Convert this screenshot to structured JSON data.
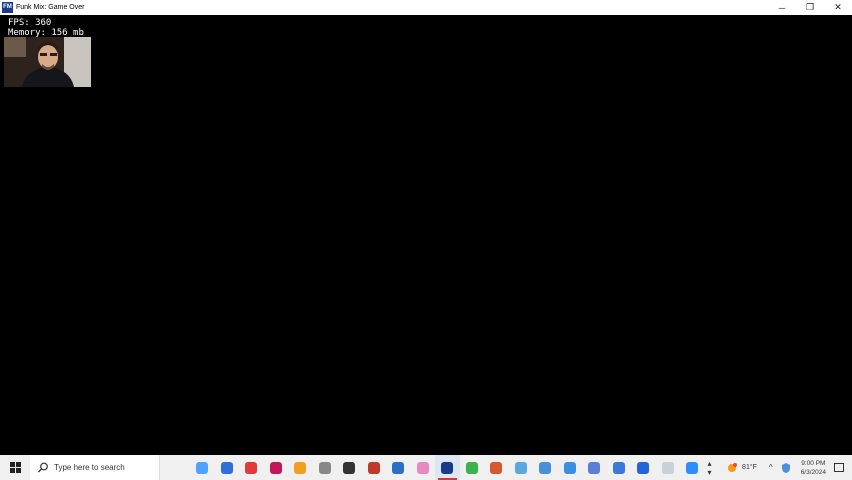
{
  "window": {
    "title": "Funk Mix: Game Over",
    "icon": "app-logo-icon",
    "icon_text": "FM",
    "controls": {
      "minimize": "─",
      "restore": "❐",
      "close": "✕"
    }
  },
  "overlay": {
    "fps_text": "FPS: 360",
    "memory_text": "Memory: 156 mb"
  },
  "webcam": {
    "label": "webcam feed"
  },
  "taskbar": {
    "search_placeholder": "Type here to search",
    "apps": [
      {
        "name": "app-1",
        "color": "#4da3ff"
      },
      {
        "name": "app-2",
        "color": "#2f6fd8"
      },
      {
        "name": "app-3",
        "color": "#e03a3a"
      },
      {
        "name": "app-4",
        "color": "#c2185b"
      },
      {
        "name": "app-5",
        "color": "#f0a020"
      },
      {
        "name": "app-6",
        "color": "#888888"
      },
      {
        "name": "app-7",
        "color": "#333333"
      },
      {
        "name": "app-8",
        "color": "#c0392b"
      },
      {
        "name": "app-9",
        "color": "#2b6fc9"
      },
      {
        "name": "app-10",
        "color": "#e88ac0"
      },
      {
        "name": "app-11",
        "color": "#1b3a8a",
        "active": true
      },
      {
        "name": "app-12",
        "color": "#3bb34a"
      },
      {
        "name": "app-13",
        "color": "#d9572e"
      },
      {
        "name": "app-14",
        "color": "#5aa8e0"
      },
      {
        "name": "app-15",
        "color": "#4a90d9"
      },
      {
        "name": "app-16",
        "color": "#3a8fe0"
      },
      {
        "name": "app-17",
        "color": "#5b7fd8"
      },
      {
        "name": "app-18",
        "color": "#3b79d8"
      },
      {
        "name": "app-19",
        "color": "#2563d9"
      },
      {
        "name": "app-20",
        "color": "#c8d0d8"
      },
      {
        "name": "app-21",
        "color": "#2d8cff"
      }
    ],
    "weather_temp": "81°F",
    "time": "9:00 PM",
    "date": "6/3/2024"
  }
}
